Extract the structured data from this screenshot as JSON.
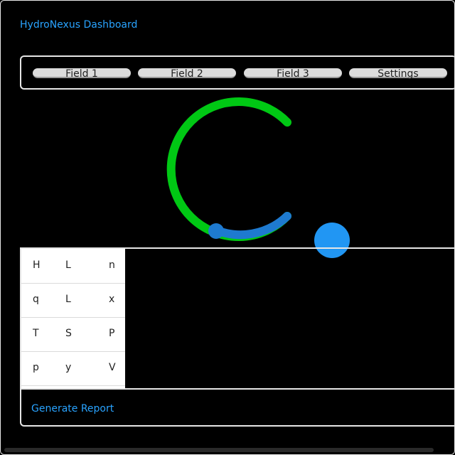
{
  "app": {
    "title": "HydroNexus Dashboard"
  },
  "tabs": [
    {
      "label": "Field 1"
    },
    {
      "label": "Field 2"
    },
    {
      "label": "Field 3"
    },
    {
      "label": "Settings"
    }
  ],
  "gauge": {
    "track_color": "#00c814",
    "fill_color": "#1e7ad0",
    "knob_color": "#1e7ad0"
  },
  "action_dot": {
    "color": "#2196f3"
  },
  "grid": {
    "rows": [
      [
        "H",
        "L",
        "n"
      ],
      [
        "q",
        "L",
        "x"
      ],
      [
        "T",
        "S",
        "P"
      ],
      [
        "p",
        "y",
        "V"
      ]
    ]
  },
  "footer": {
    "report_label": "Generate Report"
  },
  "colors": {
    "accent": "#29a3ff",
    "background": "#000000"
  }
}
